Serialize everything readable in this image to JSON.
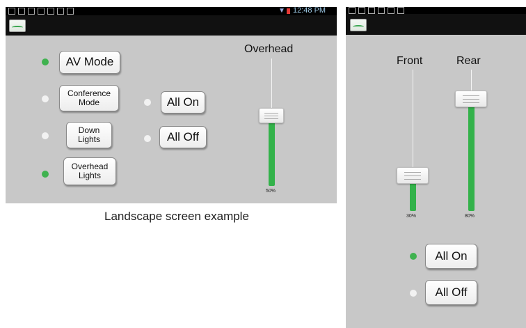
{
  "status_bar": {
    "time": "12:48 PM"
  },
  "landscape": {
    "mode_buttons": [
      {
        "label": "AV Mode",
        "indicator": "on"
      },
      {
        "label": "Conference Mode",
        "indicator": "off"
      },
      {
        "label": "Down Lights",
        "indicator": "off"
      },
      {
        "label": "Overhead Lights",
        "indicator": "on"
      }
    ],
    "all_on_label": "All On",
    "all_off_label": "All Off",
    "slider": {
      "label": "Overhead",
      "value_text": "50%",
      "value": 50
    },
    "caption": "Landscape screen example"
  },
  "portrait": {
    "sliders": [
      {
        "label": "Front",
        "value_text": "30%",
        "value": 30
      },
      {
        "label": "Rear",
        "value_text": "80%",
        "value": 80
      }
    ],
    "all_on_label": "All On",
    "all_on_indicator": "on",
    "all_off_label": "All Off",
    "all_off_indicator": "off"
  },
  "colors": {
    "indicator_on": "#3fb24f",
    "slider_fill": "#33b24a",
    "panel": "#c8c8c8"
  }
}
